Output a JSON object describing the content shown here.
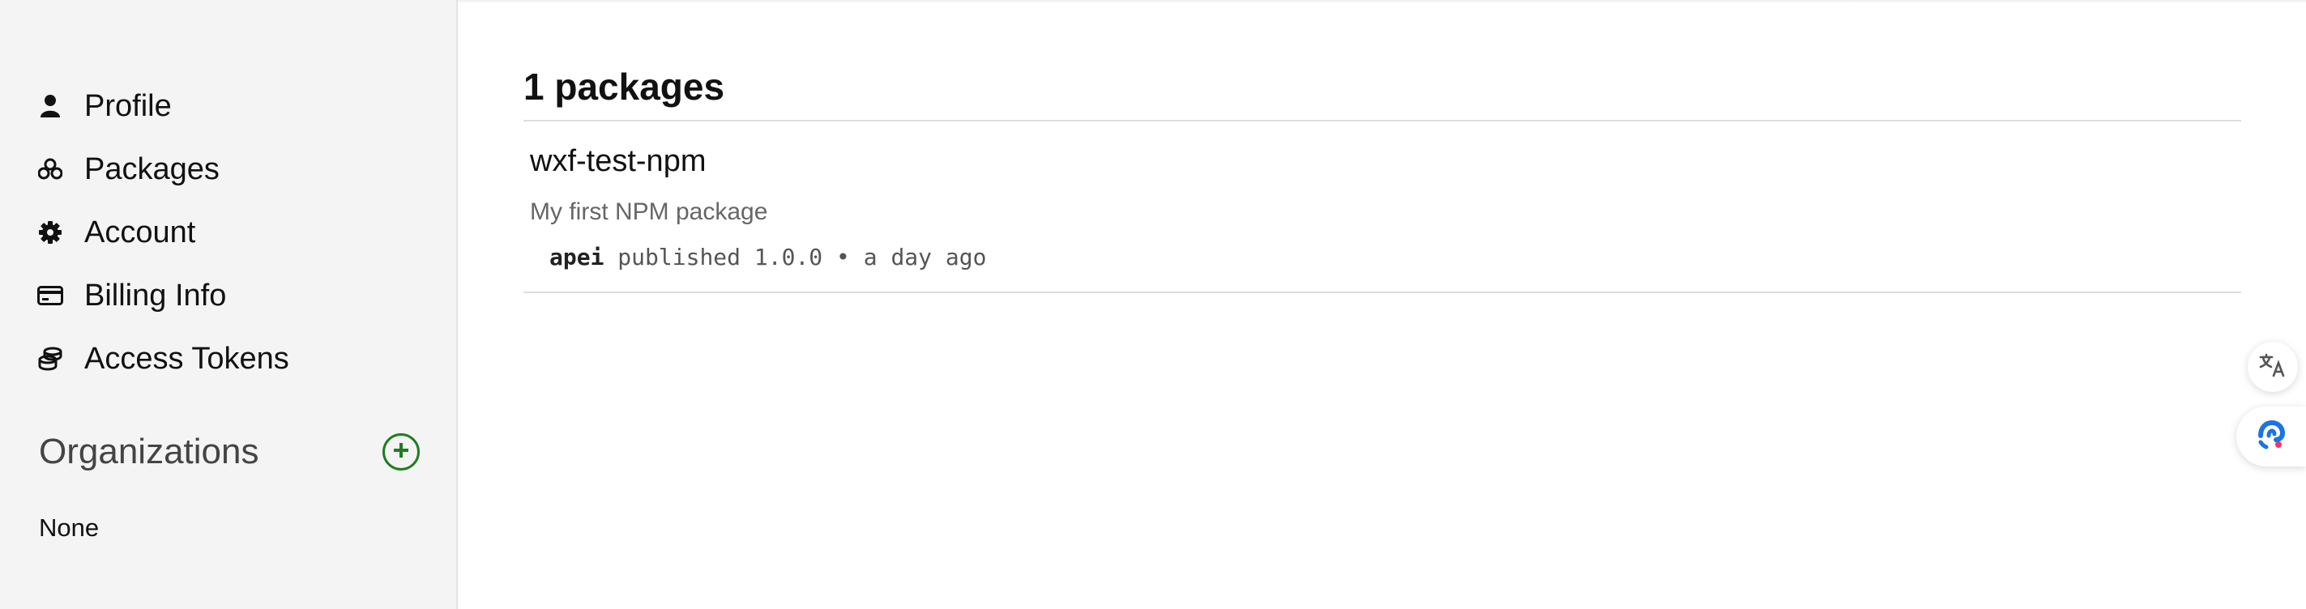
{
  "sidebar": {
    "items": [
      {
        "label": "Profile",
        "icon": "person-icon"
      },
      {
        "label": "Packages",
        "icon": "packages-icon"
      },
      {
        "label": "Account",
        "icon": "gear-icon"
      },
      {
        "label": "Billing Info",
        "icon": "credit-card-icon"
      },
      {
        "label": "Access Tokens",
        "icon": "coins-icon"
      }
    ],
    "organizations": {
      "title": "Organizations",
      "empty_text": "None",
      "add_icon": "plus-circle-icon"
    }
  },
  "main": {
    "heading": "1 packages",
    "packages": [
      {
        "name": "wxf-test-npm",
        "description": "My first NPM package",
        "publisher": "apei",
        "published_text": " published 1.0.0 • a day ago"
      }
    ]
  },
  "floating": {
    "translate_icon": "translate-icon",
    "assistant_icon": "assistant-icon"
  },
  "colors": {
    "sidebar_bg": "#f4f4f4",
    "accent_green": "#1e7d1e",
    "assistant_blue": "#1a73e8"
  }
}
